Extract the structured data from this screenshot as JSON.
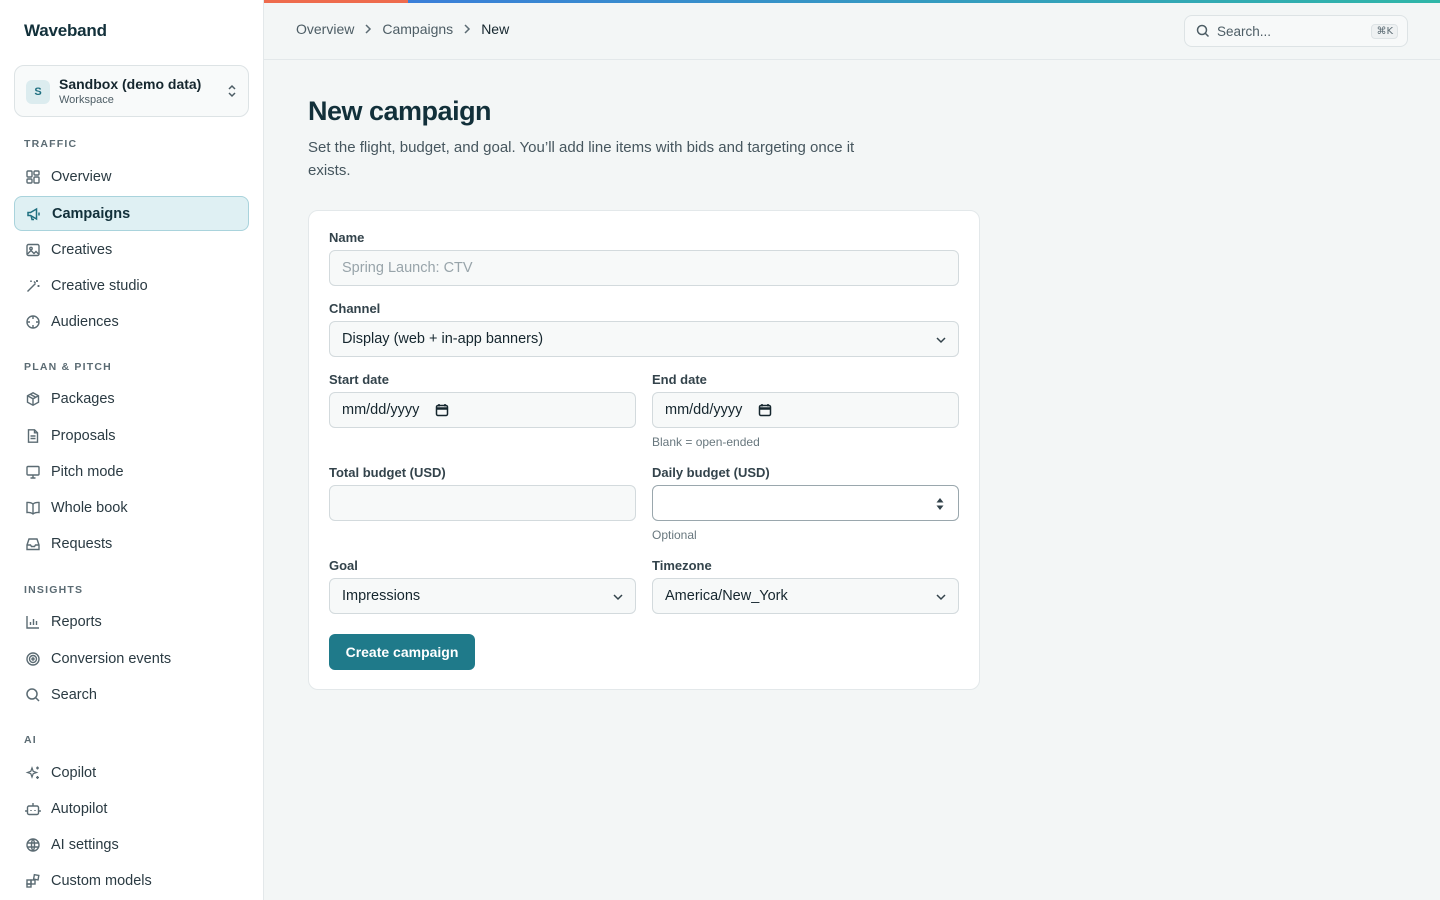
{
  "app": {
    "brand": "Waveband"
  },
  "workspace": {
    "avatar": "S",
    "name": "Sandbox (demo data)",
    "subtitle": "Workspace"
  },
  "sidebar": {
    "sections": [
      {
        "label": "TRAFFIC",
        "items": [
          {
            "label": "Overview",
            "icon": "grid-icon"
          },
          {
            "label": "Campaigns",
            "icon": "megaphone-icon",
            "active": true
          },
          {
            "label": "Creatives",
            "icon": "image-icon"
          },
          {
            "label": "Creative studio",
            "icon": "magic-wand-icon"
          },
          {
            "label": "Audiences",
            "icon": "target-icon"
          }
        ]
      },
      {
        "label": "PLAN & PITCH",
        "items": [
          {
            "label": "Packages",
            "icon": "package-icon"
          },
          {
            "label": "Proposals",
            "icon": "document-icon"
          },
          {
            "label": "Pitch mode",
            "icon": "presentation-icon"
          },
          {
            "label": "Whole book",
            "icon": "book-icon"
          },
          {
            "label": "Requests",
            "icon": "inbox-icon"
          }
        ]
      },
      {
        "label": "INSIGHTS",
        "items": [
          {
            "label": "Reports",
            "icon": "bar-chart-icon"
          },
          {
            "label": "Conversion events",
            "icon": "bullseye-icon"
          },
          {
            "label": "Search",
            "icon": "search-icon"
          }
        ]
      },
      {
        "label": "AI",
        "items": [
          {
            "label": "Copilot",
            "icon": "sparkles-icon"
          },
          {
            "label": "Autopilot",
            "icon": "robot-icon"
          },
          {
            "label": "AI settings",
            "icon": "globe-icon"
          },
          {
            "label": "Custom models",
            "icon": "blocks-icon"
          }
        ]
      }
    ]
  },
  "breadcrumb": [
    "Overview",
    "Campaigns",
    "New"
  ],
  "search": {
    "placeholder": "Search...",
    "shortcut": "⌘K"
  },
  "page": {
    "title": "New campaign",
    "description": "Set the flight, budget, and goal. You’ll add line items with bids and targeting once it exists."
  },
  "form": {
    "name": {
      "label": "Name",
      "placeholder": "Spring Launch: CTV",
      "value": ""
    },
    "channel": {
      "label": "Channel",
      "value": "Display (web + in-app banners)"
    },
    "start_date": {
      "label": "Start date",
      "value": "mm/dd/yyyy"
    },
    "end_date": {
      "label": "End date",
      "value": "mm/dd/yyyy",
      "hint": "Blank = open-ended"
    },
    "total_budget": {
      "label": "Total budget (USD)",
      "value": ""
    },
    "daily_budget": {
      "label": "Daily budget (USD)",
      "value": "",
      "hint": "Optional"
    },
    "goal": {
      "label": "Goal",
      "value": "Impressions"
    },
    "timezone": {
      "label": "Timezone",
      "value": "America/New_York"
    },
    "submit_label": "Create campaign"
  },
  "colors": {
    "accent": "#1f7a8a",
    "active_bg": "#dff0f3",
    "active_border": "#a9d3dc"
  }
}
